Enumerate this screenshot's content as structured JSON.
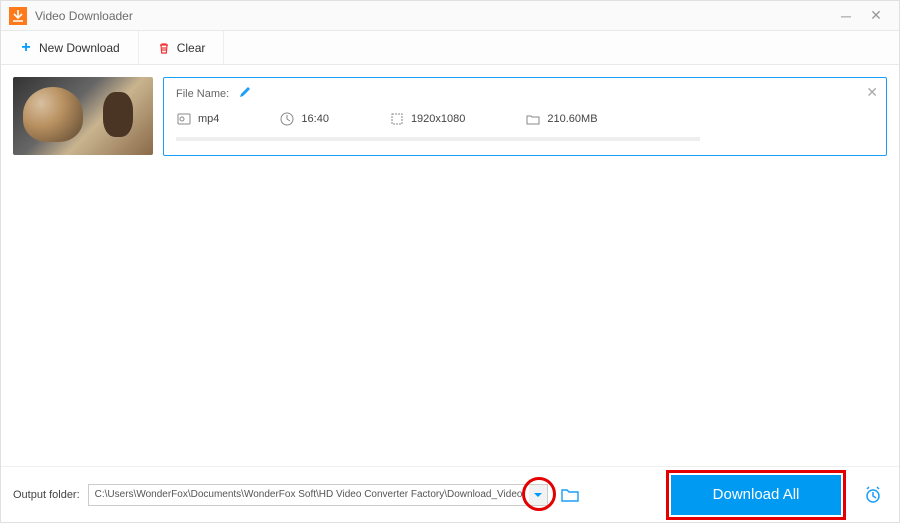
{
  "window": {
    "title": "Video Downloader"
  },
  "toolbar": {
    "new_download_label": "New Download",
    "clear_label": "Clear"
  },
  "item": {
    "file_name_label": "File Name:",
    "format": "mp4",
    "duration": "16:40",
    "resolution": "1920x1080",
    "size": "210.60MB"
  },
  "footer": {
    "output_label": "Output folder:",
    "output_path": "C:\\Users\\WonderFox\\Documents\\WonderFox Soft\\HD Video Converter Factory\\Download_Video\\",
    "download_all_label": "Download All"
  }
}
